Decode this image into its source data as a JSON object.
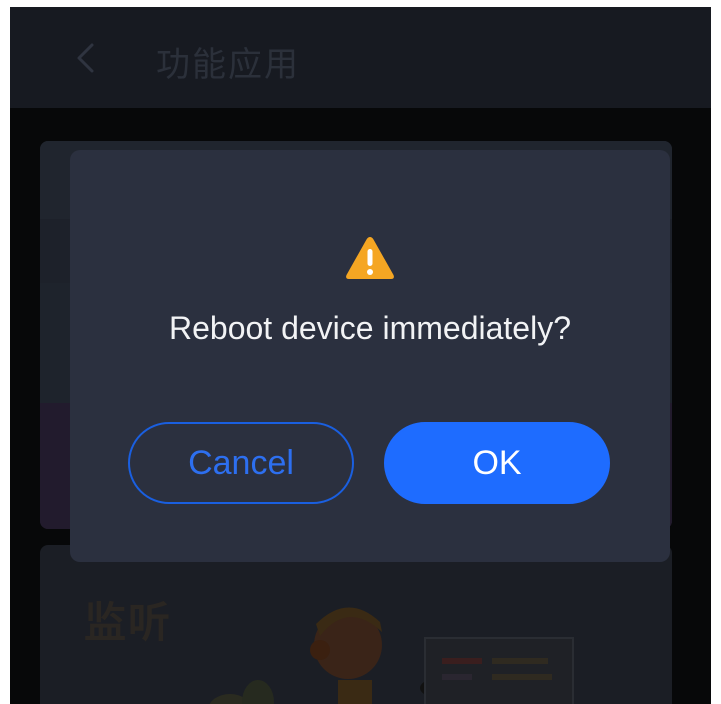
{
  "header": {
    "title": "功能应用",
    "back_icon": "chevron-left-icon"
  },
  "background_card": {
    "title": "监听"
  },
  "dialog": {
    "icon": "warning-icon",
    "message": "Reboot device immediately?",
    "cancel_label": "Cancel",
    "ok_label": "OK"
  },
  "colors": {
    "dialog_bg": "#2b303f",
    "primary": "#1e6cff",
    "warning": "#f5a623",
    "screen_bg": "#070809"
  }
}
